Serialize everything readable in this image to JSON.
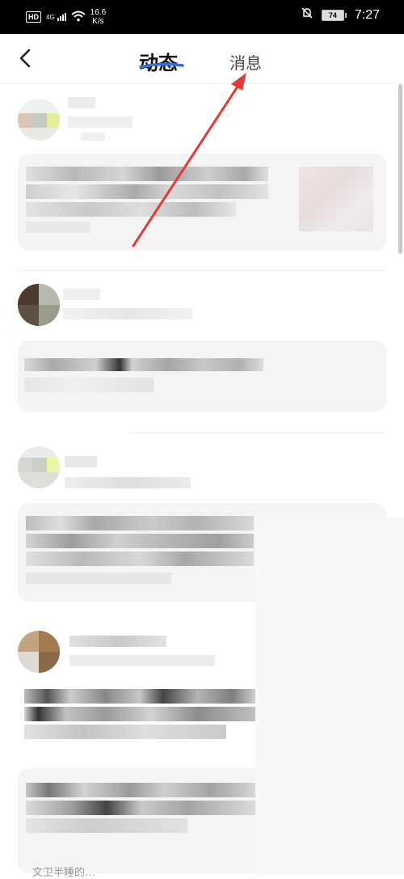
{
  "status_bar": {
    "network_badge": "HD",
    "signal_label": "4G",
    "speed_value": "16.6",
    "speed_unit": "K/s",
    "battery_level": "74",
    "time": "7:27"
  },
  "header": {
    "tab_active": "动态",
    "tab_messages": "消息"
  },
  "feed": {
    "bottom_partial_text": "文卫半睡的…"
  },
  "colors": {
    "arrow": "#e53935",
    "underline": "#2f6fe4"
  }
}
